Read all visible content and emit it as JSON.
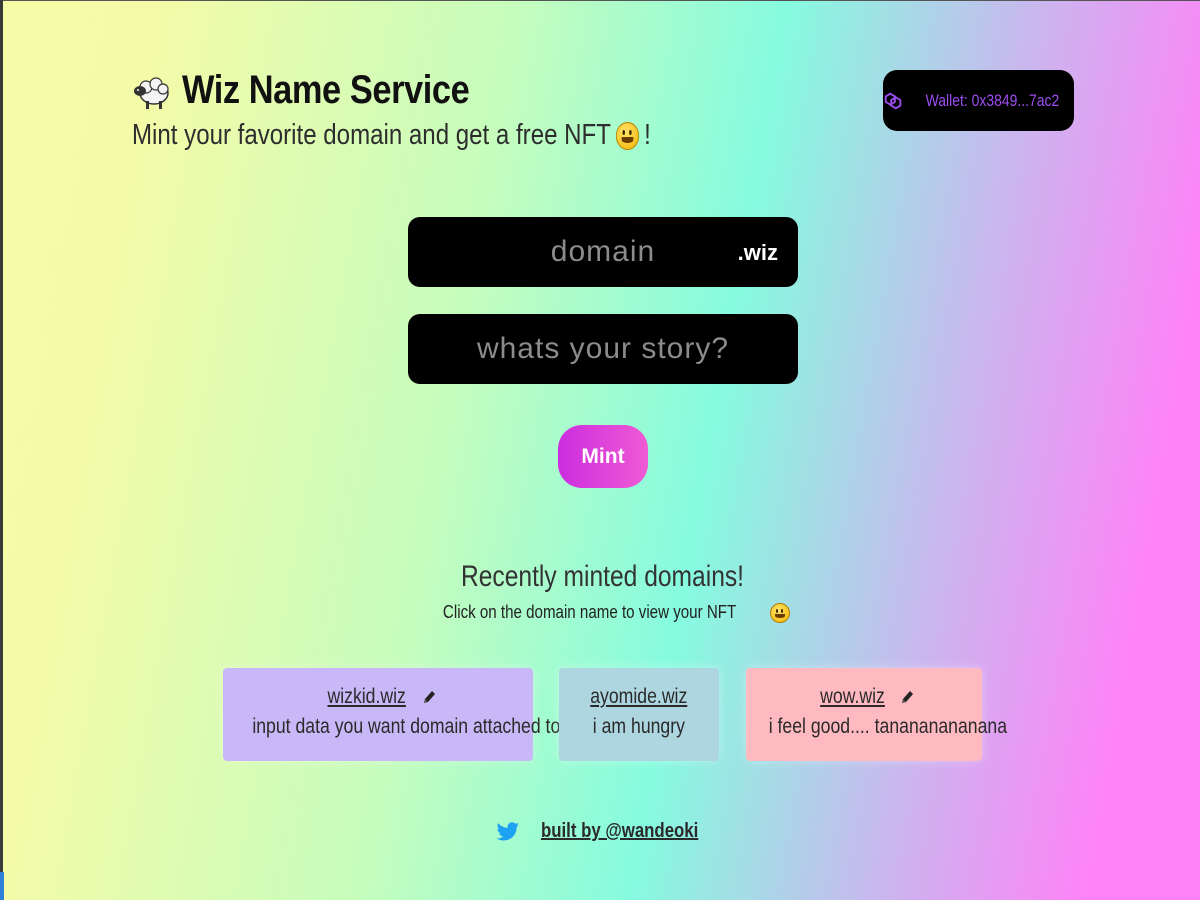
{
  "header": {
    "title": "Wiz Name Service",
    "subtitle": "Mint your favorite domain and get a free NFT",
    "subtitle_suffix": "!"
  },
  "wallet": {
    "label": "Wallet: 0x3849...7ac2"
  },
  "form": {
    "domain_placeholder": "domain",
    "tld": ".wiz",
    "record_placeholder": "whats your story?",
    "mint_label": "Mint"
  },
  "recent": {
    "title": "Recently minted domains!",
    "subtitle": "Click on the domain name to view your NFT",
    "cards": [
      {
        "domain": "wizkid.wiz",
        "record": "input data you want domain attached to",
        "editable": true,
        "color": "#c9b8f7"
      },
      {
        "domain": "ayomide.wiz",
        "record": "i am hungry",
        "editable": false,
        "color": "#aed6e1"
      },
      {
        "domain": "wow.wiz",
        "record": "i feel good.... tananananananа",
        "editable": true,
        "color": "#ffb9c1"
      }
    ]
  },
  "footer": {
    "label": "built by @wandeoki"
  },
  "colors": {
    "accent": "#9d4ef0",
    "mint_start": "#cc2ddf",
    "mint_end": "#ef5ad4",
    "twitter": "#1da1f2"
  },
  "icons": [
    "sheep-icon",
    "smiley-emoji-icon",
    "polygon-icon",
    "pencil-icon",
    "twitter-icon"
  ]
}
